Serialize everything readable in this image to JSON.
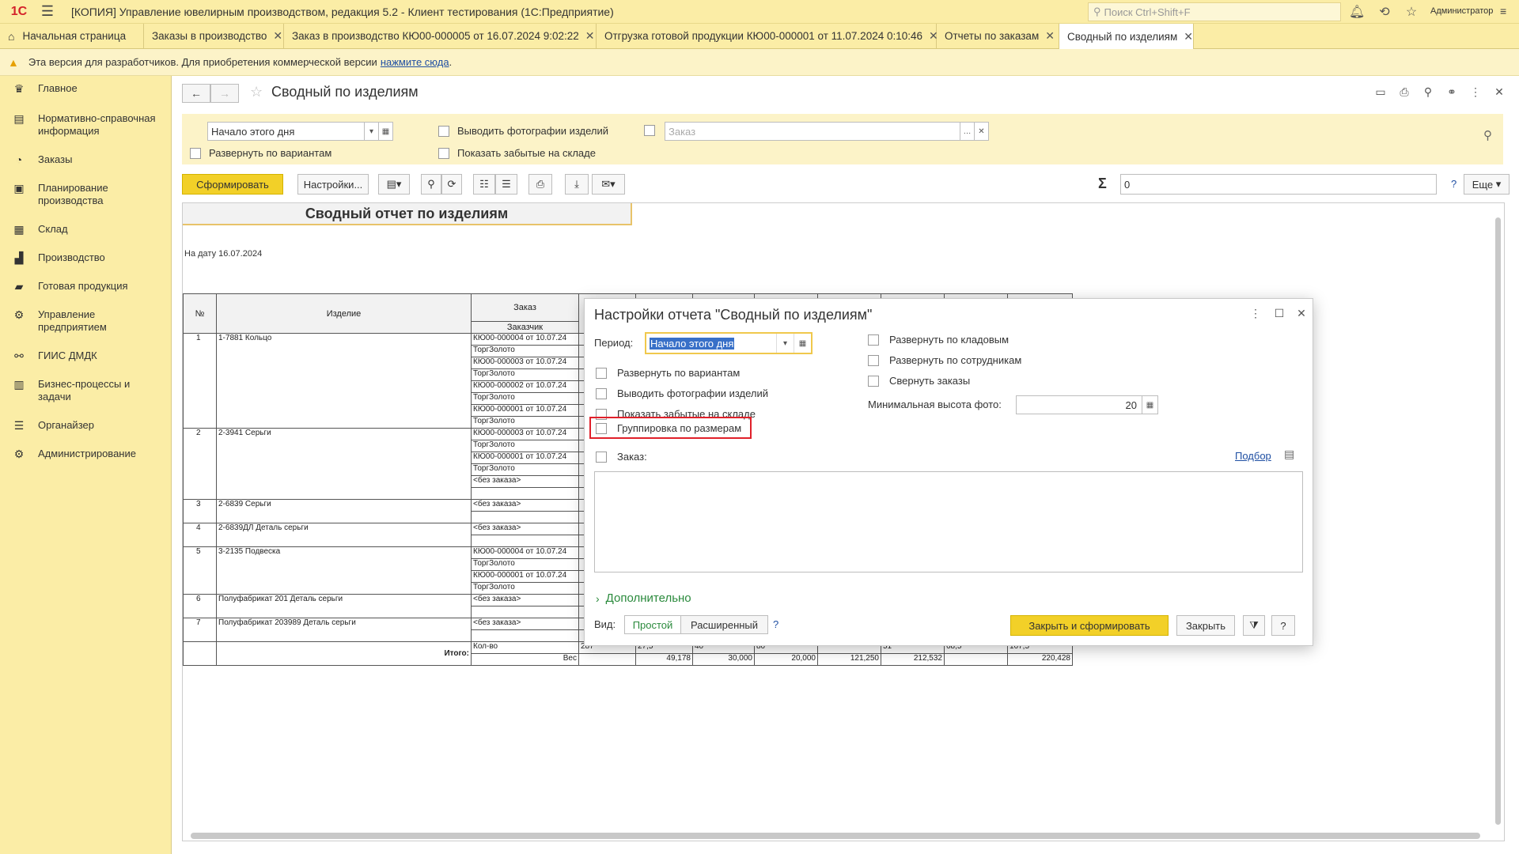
{
  "app": {
    "logo": "1С",
    "title": "[КОПИЯ] Управление ювелирным производством, редакция 5.2  - Клиент тестирования (1С:Предприятие)",
    "search_placeholder": "Поиск Ctrl+Shift+F",
    "user": "Администратор"
  },
  "tabs": [
    {
      "label": "Начальная страница"
    },
    {
      "label": "Заказы в производство"
    },
    {
      "label": "Заказ в производство КЮ00-000005 от 16.07.2024 9:02:22"
    },
    {
      "label": "Отгрузка готовой продукции КЮ00-000001 от 11.07.2024 0:10:46"
    },
    {
      "label": "Отчеты по заказам"
    },
    {
      "label": "Сводный по изделиям"
    }
  ],
  "warning": {
    "text": "Эта версия для разработчиков. Для приобретения коммерческой версии",
    "link": "нажмите сюда",
    "tail": "."
  },
  "sidebar": {
    "items": [
      {
        "label": "Главное",
        "icon": "crown-icon"
      },
      {
        "label": "Нормативно-справочная информация",
        "icon": "book-icon"
      },
      {
        "label": "Заказы",
        "icon": "pie-icon"
      },
      {
        "label": "Планирование производства",
        "icon": "clipboard-icon"
      },
      {
        "label": "Склад",
        "icon": "grid-icon"
      },
      {
        "label": "Производство",
        "icon": "factory-icon"
      },
      {
        "label": "Готовая продукция",
        "icon": "bag-icon"
      },
      {
        "label": "Управление предприятием",
        "icon": "org-icon"
      },
      {
        "label": "ГИИС ДМДК",
        "icon": "link-icon"
      },
      {
        "label": "Бизнес-процессы и задачи",
        "icon": "tasks-icon"
      },
      {
        "label": "Органайзер",
        "icon": "organizer-icon"
      },
      {
        "label": "Администрирование",
        "icon": "gear-icon"
      }
    ]
  },
  "form": {
    "title": "Сводный по изделиям",
    "filters": {
      "period_value": "Начало этого дня",
      "expand_variants": "Развернуть по вариантам",
      "show_photos": "Выводить фотографии изделий",
      "show_forgotten": "Показать забытые на складе",
      "order_placeholder": "Заказ"
    },
    "toolbar": {
      "generate": "Сформировать",
      "settings": "Настройки...",
      "more": "Еще",
      "sum_value": "0",
      "help": "?"
    }
  },
  "report": {
    "title": "Сводный отчет по изделиям",
    "date": "На дату 16.07.2024",
    "headers": {
      "num": "№",
      "item": "Изделие",
      "order": "Заказ",
      "customer": "Заказчик"
    },
    "rows": [
      {
        "num": "1",
        "item": "1-7881 Кольцо",
        "lines": [
          "КЮ00-000004 от 10.07.24",
          "ТоргЗолото",
          "КЮ00-000003 от 10.07.24",
          "ТоргЗолото",
          "КЮ00-000002 от 10.07.24",
          "ТоргЗолото",
          "КЮ00-000001 от 10.07.24",
          "ТоргЗолото"
        ]
      },
      {
        "num": "2",
        "item": "2-3941 Серьги",
        "lines": [
          "КЮ00-000003 от 10.07.24",
          "ТоргЗолото",
          "КЮ00-000001 от 10.07.24",
          "ТоргЗолото",
          "<без заказа>",
          ""
        ]
      },
      {
        "num": "3",
        "item": "2-6839 Серьги",
        "lines": [
          "<без заказа>",
          ""
        ]
      },
      {
        "num": "4",
        "item": "2-6839ДЛ Деталь серьги",
        "lines": [
          "<без заказа>",
          ""
        ]
      },
      {
        "num": "5",
        "item": "3-2135 Подвеска",
        "lines": [
          "КЮ00-000004 от 10.07.24",
          "ТоргЗолото",
          "КЮ00-000001 от 10.07.24",
          "ТоргЗолото"
        ]
      },
      {
        "num": "6",
        "item": "Полуфабрикат 201 Деталь серьги",
        "lines": [
          "<без заказа>",
          ""
        ]
      },
      {
        "num": "7",
        "item": "Полуфабрикат 203989 Деталь серьги",
        "lines": [
          "<без заказа>",
          ""
        ]
      }
    ],
    "totals": {
      "label": "Итого:",
      "qty_label": "Кол-во",
      "weight_label": "Вес",
      "qty": [
        "287",
        "27,5",
        "40",
        "80",
        "",
        "51",
        "68,5",
        "167,5"
      ],
      "weight": [
        "",
        "49,178",
        "30,000",
        "20,000",
        "121,250",
        "212,532",
        "",
        "220,428"
      ]
    }
  },
  "dialog": {
    "title": "Настройки отчета \"Сводный по изделиям\"",
    "period_label": "Период:",
    "period_value": "Начало этого дня",
    "expand_variants": "Развернуть по вариантам",
    "show_photos": "Выводить фотографии изделий",
    "show_forgotten": "Показать забытые на складе",
    "group_by_sizes": "Группировка по размерам",
    "expand_storekeepers": "Развернуть по кладовым",
    "expand_employees": "Развернуть по сотрудникам",
    "collapse_orders": "Свернуть заказы",
    "min_photo_height_label": "Минимальная высота фото:",
    "min_photo_height_value": "20",
    "order_label": "Заказ:",
    "podbor": "Подбор",
    "extra": "Дополнительно",
    "view_label": "Вид:",
    "view_simple": "Простой",
    "view_extended": "Расширенный",
    "help": "?",
    "close_and_generate": "Закрыть и сформировать",
    "close": "Закрыть"
  }
}
